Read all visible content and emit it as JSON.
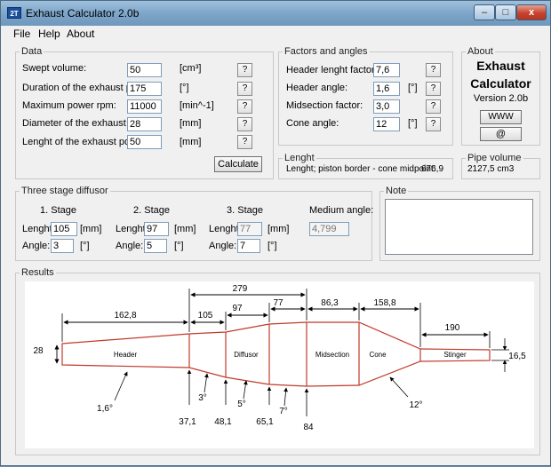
{
  "window": {
    "icon_text": "2T",
    "title": "Exhaust Calculator 2.0b",
    "minimize": "–",
    "maximize": "□",
    "close": "x"
  },
  "menu": [
    "File",
    "Help",
    "About"
  ],
  "data_group": {
    "title": "Data",
    "rows": [
      {
        "label": "Swept volume:",
        "value": "50",
        "unit": "[cm³]",
        "help": "?"
      },
      {
        "label": "Duration of the exhaust port:",
        "value": "175",
        "unit": "[°]",
        "help": "?"
      },
      {
        "label": "Maximum power rpm:",
        "value": "11000",
        "unit": "[min^-1]",
        "help": "?"
      },
      {
        "label": "Diameter of the exhaust port:",
        "value": "28",
        "unit": "[mm]",
        "help": "?"
      },
      {
        "label": "Lenght of the exhaust port:",
        "value": "50",
        "unit": "[mm]",
        "help": "?"
      }
    ],
    "calculate": "Calculate"
  },
  "factors_group": {
    "title": "Factors and angles",
    "rows": [
      {
        "label": "Header lenght factor:",
        "value": "7,6",
        "unit": "",
        "help": "?"
      },
      {
        "label": "Header angle:",
        "value": "1,6",
        "unit": "[°]",
        "help": "?"
      },
      {
        "label": "Midsection factor:",
        "value": "3,0",
        "unit": "",
        "help": "?"
      },
      {
        "label": "Cone angle:",
        "value": "12",
        "unit": "[°]",
        "help": "?"
      }
    ]
  },
  "about_group": {
    "title": "About",
    "line1": "Exhaust",
    "line2": "Calculator",
    "version": "Version 2.0b",
    "www": "WWW",
    "email": "@"
  },
  "lenght_group": {
    "title": "Lenght",
    "text": "Lenght; piston border - cone midpoint:",
    "value": "676,9"
  },
  "pipe_volume_group": {
    "title": "Pipe volume",
    "value": "2127,5 cm3"
  },
  "diffuser_group": {
    "title": "Three stage diffusor",
    "stages": [
      {
        "title": "1. Stage",
        "lenght_label": "Lenght:",
        "lenght": "105",
        "lenght_unit": "[mm]",
        "angle_label": "Angle:",
        "angle": "3",
        "angle_unit": "[°]"
      },
      {
        "title": "2. Stage",
        "lenght_label": "Lenght:",
        "lenght": "97",
        "lenght_unit": "[mm]",
        "angle_label": "Angle:",
        "angle": "5",
        "angle_unit": "[°]"
      },
      {
        "title": "3. Stage",
        "lenght_label": "Lenght:",
        "lenght": "77",
        "lenght_unit": "[mm]",
        "angle_label": "Angle:",
        "angle": "7",
        "angle_unit": "[°]"
      }
    ],
    "medium_angle_label": "Medium angle:",
    "medium_angle": "4,799"
  },
  "note_group": {
    "title": "Note"
  },
  "results_group": {
    "title": "Results",
    "sections": [
      "Header",
      "Diffusor",
      "Midsection",
      "Cone",
      "Stinger"
    ],
    "dims_top": [
      "162,8",
      "105",
      "97",
      "77",
      "86,3",
      "158,8",
      "279",
      "190"
    ],
    "inlet_diameter": "28",
    "stinger_diameter": "16,5",
    "angles": [
      "1,6°",
      "3°",
      "5°",
      "7°",
      "12°"
    ],
    "diameters_bottom": [
      "37,1",
      "48,1",
      "65,1",
      "84"
    ]
  }
}
